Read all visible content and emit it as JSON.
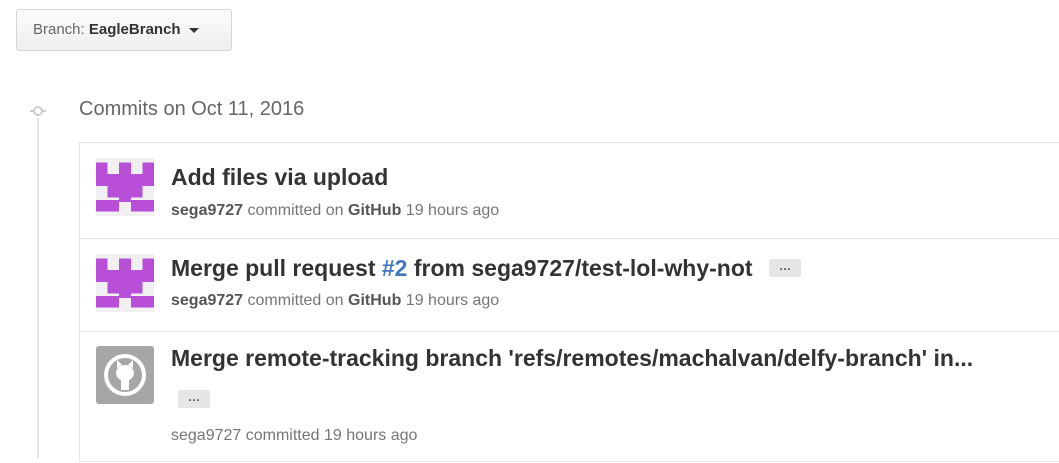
{
  "branch": {
    "prefix": "Branch:",
    "name": "EagleBranch"
  },
  "group": {
    "heading": "Commits on Oct 11, 2016"
  },
  "commits": [
    {
      "title": "Add files via upload",
      "author": "sega9727",
      "verb": "committed on",
      "platform": "GitHub",
      "time": "19 hours ago",
      "avatar": "identicon-purple"
    },
    {
      "title_pre": "Merge pull request",
      "issue": "#2",
      "title_post": "from sega9727/test-lol-why-not",
      "ellipsis": "…",
      "author": "sega9727",
      "verb": "committed on",
      "platform": "GitHub",
      "time": "19 hours ago",
      "avatar": "identicon-purple"
    },
    {
      "title": "Merge remote-tracking branch 'refs/remotes/machalvan/delfy-branch' in...",
      "ellipsis": "…",
      "author": "sega9727",
      "verb": "committed",
      "time": "19 hours ago",
      "avatar": "github-octocat-icon"
    }
  ],
  "colors": {
    "link": "#4078c0",
    "identicon": "#b94fd8",
    "avatar_gray": "#a6a6a6"
  }
}
